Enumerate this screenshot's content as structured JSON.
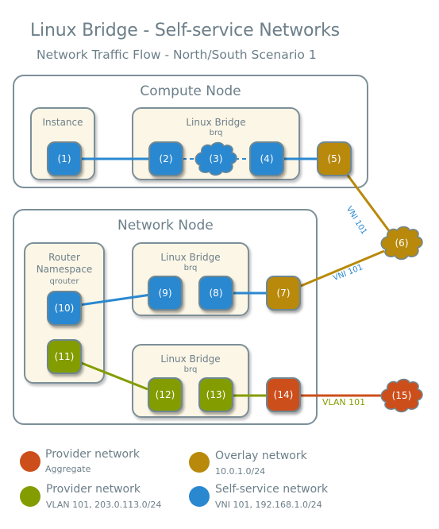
{
  "header": {
    "title": "Linux Bridge - Self-service Networks",
    "subtitle": "Network Traffic Flow - North/South Scenario 1"
  },
  "colors": {
    "self_service": "#2a88d0",
    "overlay": "#b8890b",
    "provider_vlan": "#839c00",
    "provider_aggregate": "#cc4e1b",
    "panel_fill": "#fcf6e6",
    "border": "#7c8f98"
  },
  "compute_node": {
    "label": "Compute Node",
    "instance": {
      "label": "Instance",
      "ports": [
        "(1)"
      ]
    },
    "bridge": {
      "label": "Linux Bridge",
      "sub": "brq",
      "ports": [
        "(2)",
        "(3)",
        "(4)"
      ]
    },
    "external_port": "(5)"
  },
  "overlay_cloud": "(6)",
  "network_node": {
    "label": "Network Node",
    "router": {
      "label_line1": "Router",
      "label_line2": "Namespace",
      "sub": "qrouter",
      "ports": [
        "(10)",
        "(11)"
      ]
    },
    "bridge_self_service": {
      "label": "Linux Bridge",
      "sub": "brq",
      "ports": [
        "(9)",
        "(8)"
      ]
    },
    "overlay_port": "(7)",
    "bridge_provider": {
      "label": "Linux Bridge",
      "sub": "brq",
      "ports": [
        "(12)",
        "(13)"
      ]
    },
    "provider_port": "(14)"
  },
  "provider_cloud": "(15)",
  "link_labels": {
    "vni_upper": "VNI 101",
    "vni_lower": "VNI 101",
    "vlan": "VLAN 101"
  },
  "legend": [
    {
      "title": "Provider network",
      "sub": "Aggregate",
      "color": "#cc4e1b"
    },
    {
      "title": "Overlay network",
      "sub": "10.0.1.0/24",
      "color": "#b8890b"
    },
    {
      "title": "Provider network",
      "sub": "VLAN 101, 203.0.113.0/24",
      "color": "#839c00"
    },
    {
      "title": "Self-service network",
      "sub": "VNI 101, 192.168.1.0/24",
      "color": "#2a88d0"
    }
  ]
}
